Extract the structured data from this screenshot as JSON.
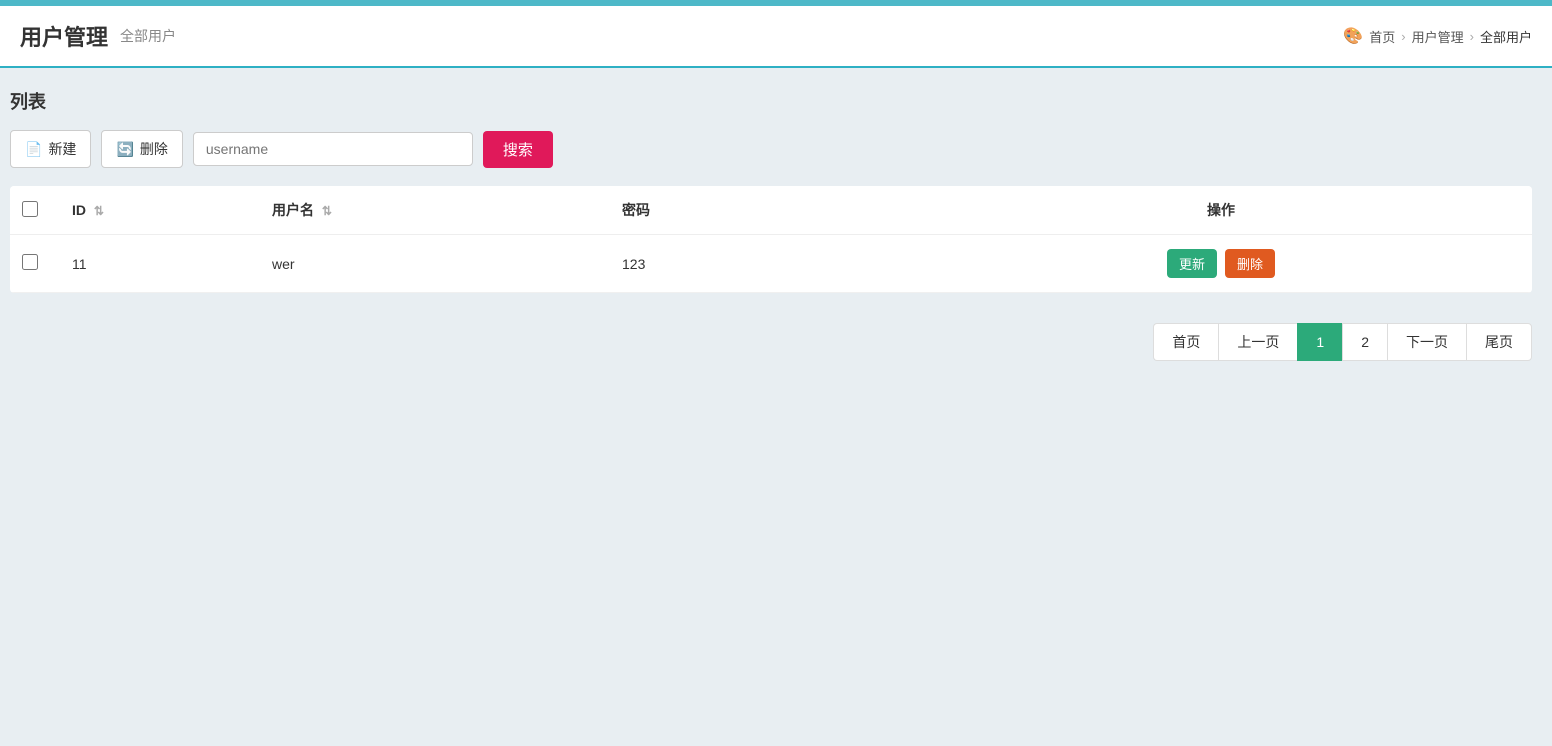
{
  "topbar": {
    "color": "#4db8c8"
  },
  "header": {
    "title": "用户管理",
    "subtitle": "全部用户",
    "breadcrumb": {
      "icon": "🎨",
      "items": [
        "首页",
        "用户管理",
        "全部用户"
      ]
    }
  },
  "section": {
    "title": "列表"
  },
  "toolbar": {
    "new_label": "新建",
    "delete_label": "删除",
    "search_placeholder": "username",
    "search_label": "搜索"
  },
  "table": {
    "columns": [
      {
        "key": "check",
        "label": ""
      },
      {
        "key": "id",
        "label": "ID"
      },
      {
        "key": "username",
        "label": "用户名"
      },
      {
        "key": "password",
        "label": "密码"
      },
      {
        "key": "action",
        "label": "操作"
      }
    ],
    "rows": [
      {
        "id": "11",
        "username": "wer",
        "password": "123"
      }
    ],
    "row_actions": {
      "update_label": "更新",
      "delete_label": "删除"
    }
  },
  "pagination": {
    "first_label": "首页",
    "prev_label": "上一页",
    "pages": [
      "1",
      "2"
    ],
    "active_page": "1",
    "next_label": "下一页",
    "last_label": "尾页"
  }
}
